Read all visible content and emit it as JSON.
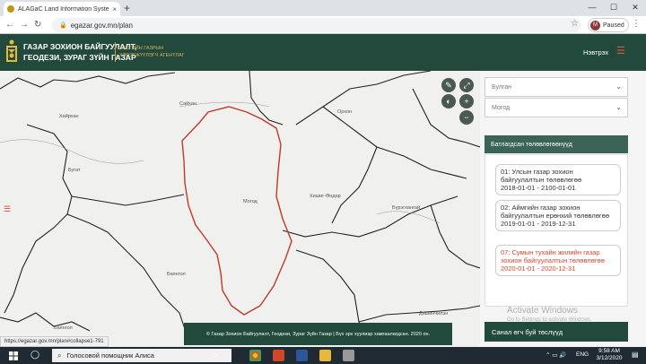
{
  "browser": {
    "tab_title": "ALAGaC Land Information Syste",
    "tab_close": "×",
    "new_tab": "+",
    "url": "egazar.gov.mn/plan",
    "profile_initial": "M",
    "profile_label": "Paused",
    "win_min": "—",
    "win_max": "☐",
    "win_close": "✕"
  },
  "header": {
    "agency_line1": "ГАЗАР ЗОХИОН БАЙГУУЛАЛТ,",
    "agency_line2": "ГЕОДЕЗИ, ЗУРАГ ЗҮЙН ГАЗАР",
    "sub_line1": "ЗАСГИЙН ГАЗРЫН",
    "sub_line2": "ХЭРЭГЖҮҮЛЭГЧ АГЕНТЛАГ",
    "login": "Нэвтрэх",
    "accent": "#214a3d",
    "gold": "#c8a43c"
  },
  "map": {
    "labels": {
      "saikhan": "Сайхан",
      "khairkhan": "Хайрхан",
      "orkhon": "Орхон",
      "mogod": "Могод",
      "khishig": "Хишиг-Өндөр",
      "buregkhangai": "Бүрэгхангай",
      "bayan_aguit": "Бугат",
      "biazat": "Баянгол",
      "dashinchilen": "Дашинчилэн",
      "bayangol": "Баянгол"
    },
    "copyright": "© Газар Зохион Байгуулалт, Геодези, Зураг Зүйн Газар | Бүх эрх хуулиар хамгаалагдсан. 2020 он.",
    "highlight_color": "#c0392b"
  },
  "panel": {
    "province_placeholder": "Булган",
    "soum_placeholder": "Могод",
    "approved_title": "Батлагдсан төлөвлөгөөнүүд",
    "plans": [
      {
        "title": "01: Улсын газар зохион байгуулалтын төлөвлөгөө",
        "dates": "2018-01-01 - 2100-01-01",
        "active": false
      },
      {
        "title": "02: Аймгийн газар зохион байгуулалтын ерөнхий төлөвлөгөө",
        "dates": "2019-01-01 - 2019-12-31",
        "active": false
      },
      {
        "title": "07: Сумын тухайн жилийн газар зохион байгуулалтын төлөвлөгөө",
        "dates": "2020-01-01 - 2020-12-31",
        "active": true
      }
    ],
    "suggest": "Санал өгч буй төслүүд",
    "watermark_title": "Activate Windows",
    "watermark_sub": "Go to Settings to activate Windows."
  },
  "status_url": "https://egazar.gov.mn/plan#collapse1-791",
  "taskbar": {
    "search_text": "Голосовой помощник Алиса",
    "lang": "ENG",
    "time": "9:58 AM",
    "date": "3/12/2020"
  },
  "icons": {
    "pencil": "pencil-icon",
    "expand": "expand-icon",
    "zoom_in": "plus-icon",
    "zoom_out": "minus-icon",
    "layers": "layers-icon"
  }
}
